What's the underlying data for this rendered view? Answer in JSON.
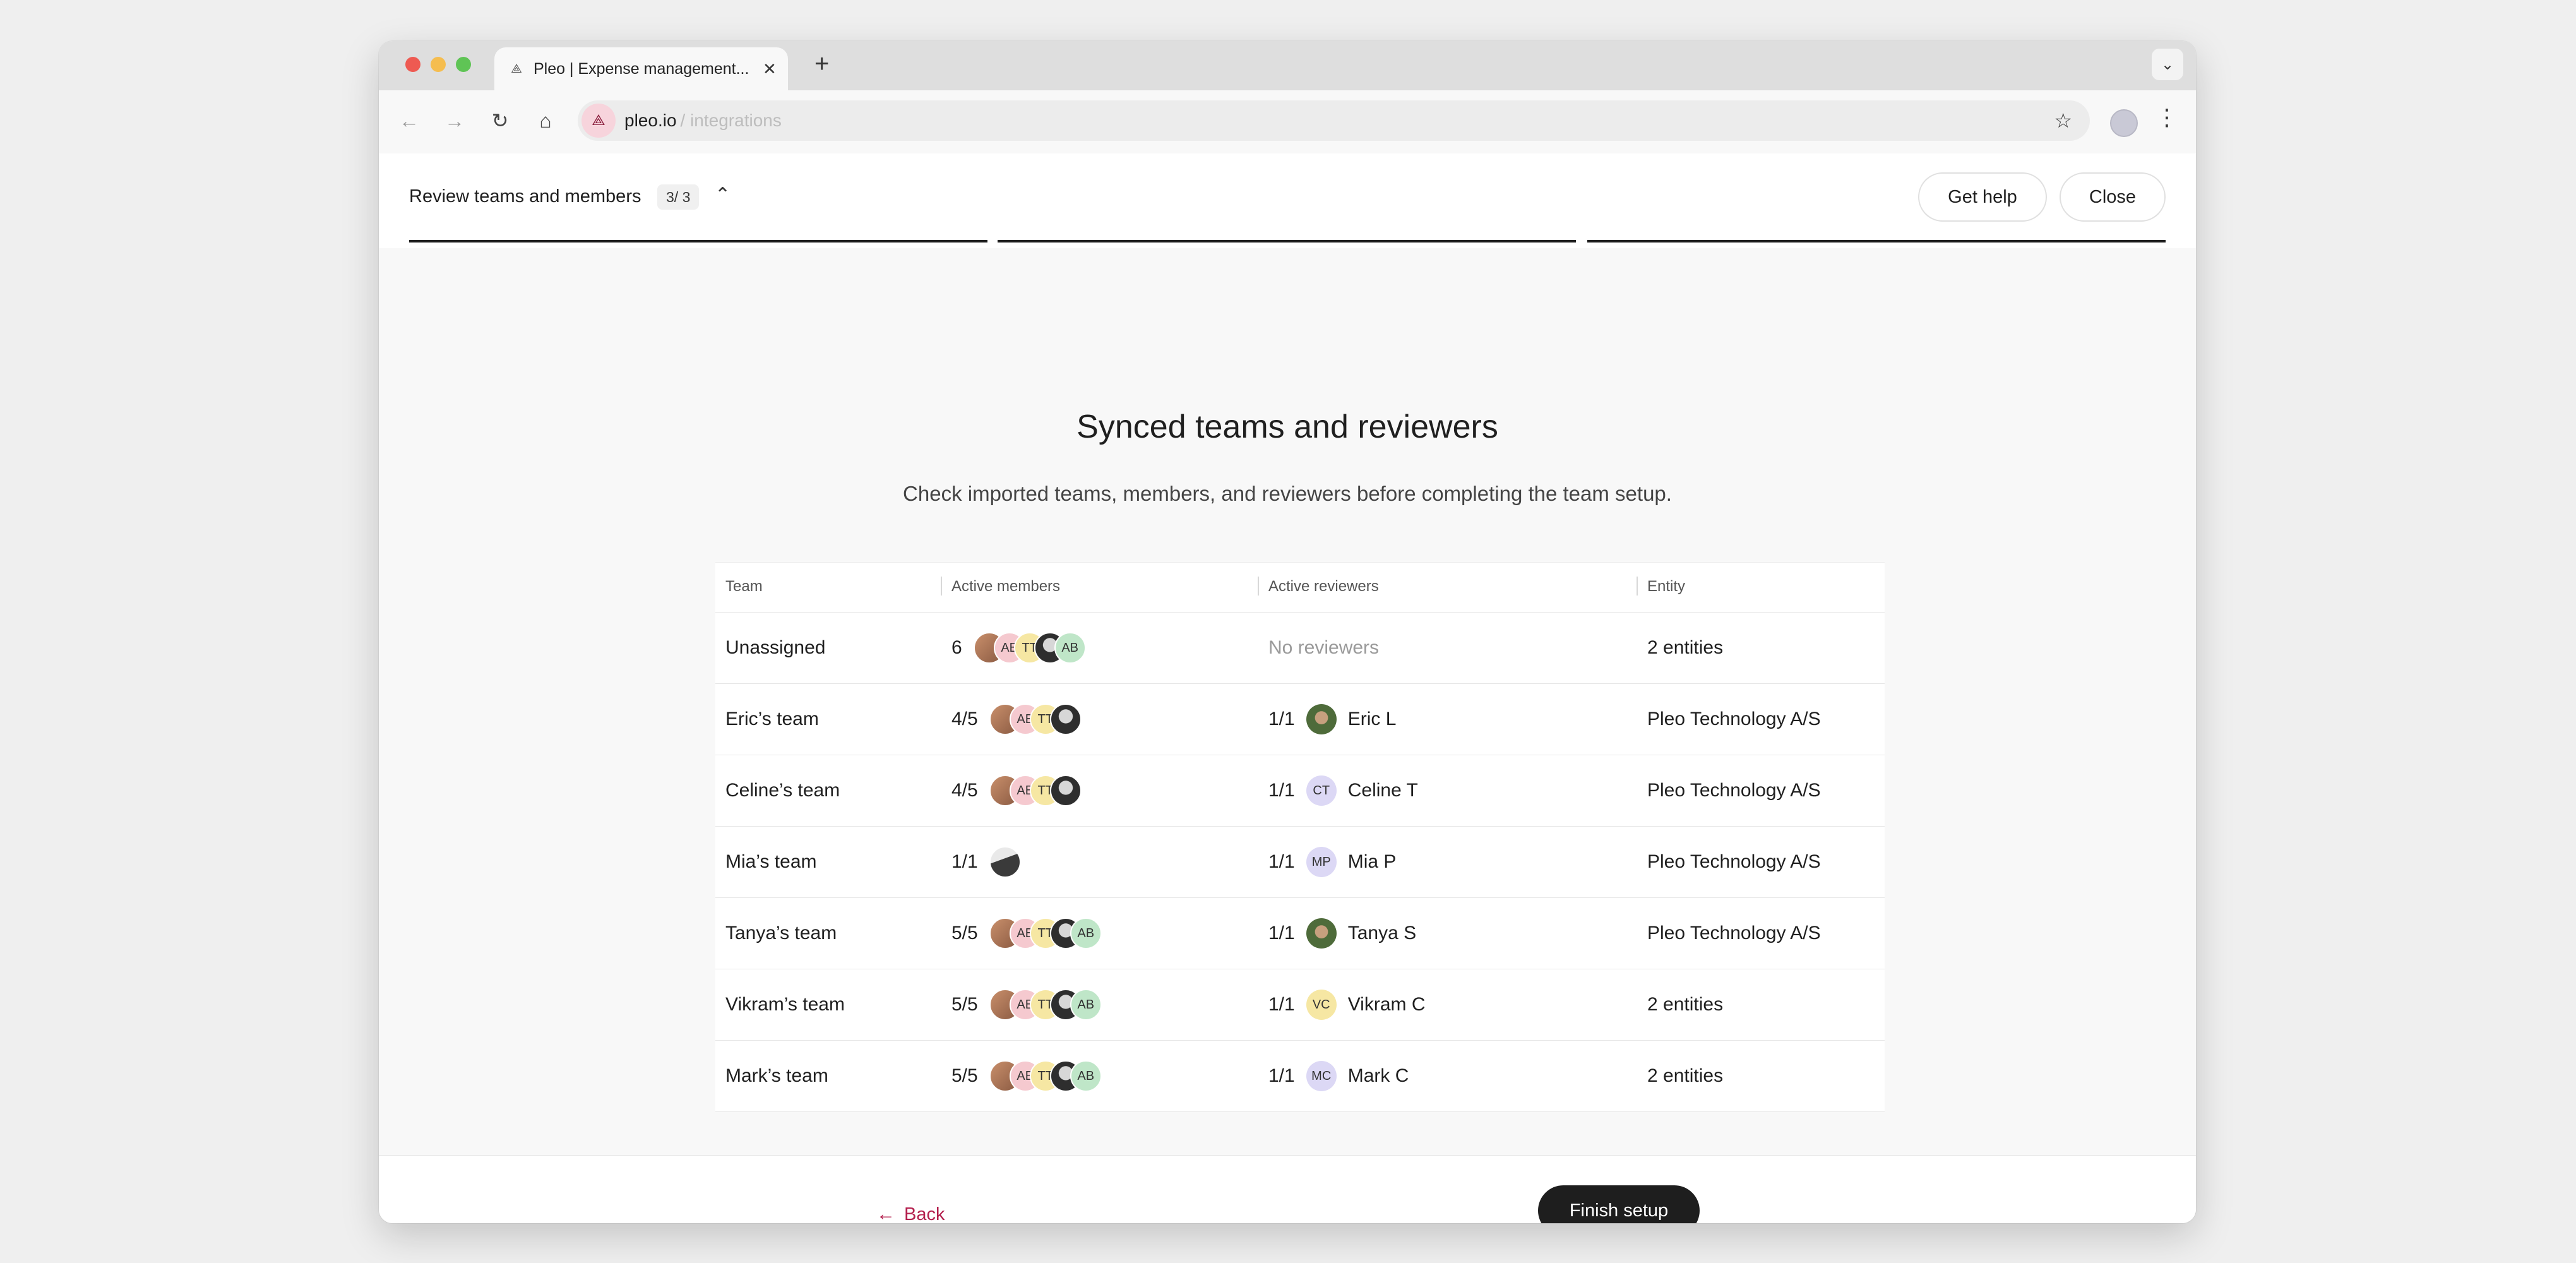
{
  "browser": {
    "tab_title": "Pleo | Expense management...",
    "url_host": "pleo.io",
    "url_path": "/ integrations",
    "new_tab_label": "+"
  },
  "stepper": {
    "title": "Review teams and members",
    "count": "3/ 3",
    "get_help_label": "Get help",
    "close_label": "Close"
  },
  "main": {
    "heading": "Synced teams and reviewers",
    "subheading": "Check imported teams, members, and reviewers before completing the team setup."
  },
  "table": {
    "headers": [
      "Team",
      "Active members",
      "Active reviewers",
      "Entity"
    ],
    "rows": [
      {
        "team": "Unassigned",
        "members_count": "6",
        "members_avatar_labels": [
          "",
          "AB",
          "TT",
          "",
          "AB"
        ],
        "reviewers_count": "",
        "reviewer": "No reviewers",
        "reviewer_initials": "",
        "entity": "2 entities"
      },
      {
        "team": "Eric’s team",
        "members_count": "4/5",
        "members_avatar_labels": [
          "",
          "AB",
          "TT",
          ""
        ],
        "reviewers_count": "1/1",
        "reviewer": "Eric L",
        "reviewer_initials": "",
        "entity": "Pleo Technology A/S"
      },
      {
        "team": "Celine’s team",
        "members_count": "4/5",
        "members_avatar_labels": [
          "",
          "AB",
          "TT",
          ""
        ],
        "reviewers_count": "1/1",
        "reviewer": "Celine T",
        "reviewer_initials": "CT",
        "entity": "Pleo Technology A/S"
      },
      {
        "team": "Mia’s team",
        "members_count": "1/1",
        "members_avatar_labels": [
          ""
        ],
        "reviewers_count": "1/1",
        "reviewer": "Mia P",
        "reviewer_initials": "MP",
        "entity": "Pleo Technology A/S"
      },
      {
        "team": "Tanya’s team",
        "members_count": "5/5",
        "members_avatar_labels": [
          "",
          "AB",
          "TT",
          "",
          "AB"
        ],
        "reviewers_count": "1/1",
        "reviewer": "Tanya S",
        "reviewer_initials": "",
        "entity": "Pleo Technology A/S"
      },
      {
        "team": "Vikram’s team",
        "members_count": "5/5",
        "members_avatar_labels": [
          "",
          "AB",
          "TT",
          "",
          "AB"
        ],
        "reviewers_count": "1/1",
        "reviewer": "Vikram C",
        "reviewer_initials": "VC",
        "entity": "2 entities"
      },
      {
        "team": "Mark’s team",
        "members_count": "5/5",
        "members_avatar_labels": [
          "",
          "AB",
          "TT",
          "",
          "AB"
        ],
        "reviewers_count": "1/1",
        "reviewer": "Mark C",
        "reviewer_initials": "MC",
        "entity": "2 entities"
      }
    ]
  },
  "footer": {
    "back_label": "Back",
    "finish_label": "Finish setup"
  },
  "colors": {
    "accent": "#b4204e",
    "primary_button": "#1e1e1e"
  }
}
